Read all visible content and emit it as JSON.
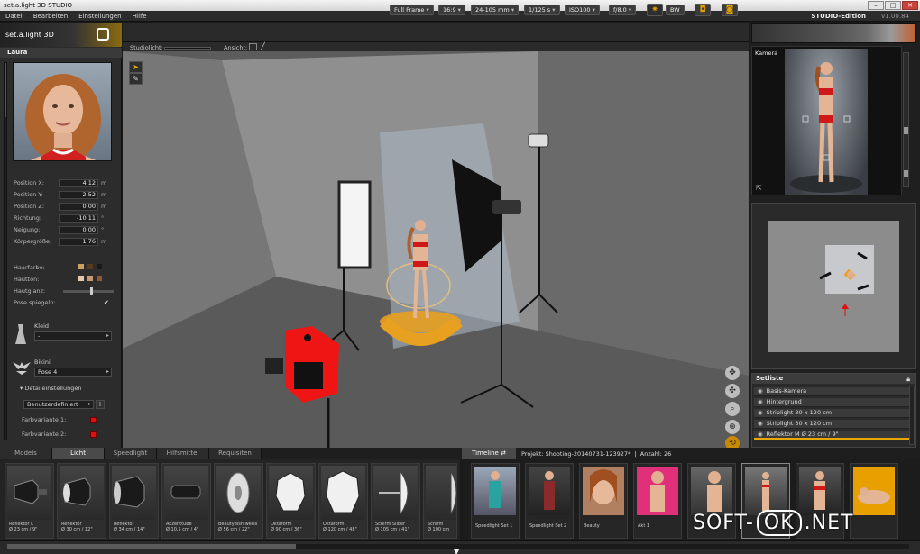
{
  "window": {
    "title": "set.a.light 3D STUDIO"
  },
  "menu": {
    "items": [
      "Datei",
      "Bearbeiten",
      "Einstellungen",
      "Hilfe"
    ],
    "edition": "STUDIO-Edition",
    "version": "v1.00.84"
  },
  "logo": {
    "text": "set.a.light 3D"
  },
  "toolbar": {
    "format": "Full Frame",
    "ratio": "16:9",
    "lens": "24-105 mm",
    "shutter": "1/125 s",
    "iso": "ISO100",
    "aperture": "f/8.0",
    "bw": "BW",
    "studiolicht_label": "Studiolicht:",
    "ansicht_label": "Ansicht:"
  },
  "model_panel": {
    "name": "Laura",
    "properties": [
      {
        "label": "Position X:",
        "value": "4.12",
        "unit": "m"
      },
      {
        "label": "Position Y:",
        "value": "2.52",
        "unit": "m"
      },
      {
        "label": "Position Z:",
        "value": "0.00",
        "unit": "m"
      },
      {
        "label": "Richtung:",
        "value": "-10.11",
        "unit": "°"
      },
      {
        "label": "Neigung:",
        "value": "0.00",
        "unit": "°"
      },
      {
        "label": "Körpergröße:",
        "value": "1.76",
        "unit": "m"
      }
    ],
    "haarfarbe": "Haarfarbe:",
    "hautton": "Hautton:",
    "hautglanz": "Hautglanz:",
    "pose_spiegeln": "Pose spiegeln:",
    "kleid_label": "Kleid",
    "kleid_value": "-",
    "bikini_label": "Bikini",
    "bikini_value": "Pose 4",
    "details_label": "Detaileinstellungen",
    "preset_value": "Benutzerdefiniert",
    "farb1": "Farbvariante 1:",
    "farb2": "Farbvariante 2:",
    "colors": {
      "hair": [
        "#c8a060",
        "#5a3a20",
        "#1a1a1a"
      ],
      "skin": [
        "#e8c8a8",
        "#c89870",
        "#8a5a3a"
      ],
      "variant": "#e01010"
    }
  },
  "camera_panel": {
    "title": "Kamera"
  },
  "setliste": {
    "title": "Setliste",
    "items": [
      "Basis-Kamera",
      "Hintergrund",
      "Striplight 30 x 120 cm",
      "Striplight 30 x 120 cm",
      "Reflektor M Ø 23 cm / 9\""
    ]
  },
  "bottom_tabs": [
    "Models",
    "Licht",
    "Speedlight",
    "Hilfsmittel",
    "Requisiten"
  ],
  "active_tab": "Licht",
  "library": [
    {
      "name": "Reflektor L",
      "size": "Ø 23 cm / 9\""
    },
    {
      "name": "Reflektor",
      "size": "Ø 30 cm / 12\""
    },
    {
      "name": "Reflektor",
      "size": "Ø 34 cm / 14\""
    },
    {
      "name": "Akzenttube",
      "size": "Ø 10,5 cm / 4\""
    },
    {
      "name": "Beautydish weiss",
      "size": "Ø 56 cm / 22\""
    },
    {
      "name": "Oktaform",
      "size": "Ø 90 cm / 36\""
    },
    {
      "name": "Oktaform",
      "size": "Ø 120 cm / 48\""
    },
    {
      "name": "Schirm Silber",
      "size": "Ø 105 cm / 41\""
    },
    {
      "name": "Schirm T",
      "size": "Ø 100 cm"
    }
  ],
  "timeline": {
    "tab": "Timeline",
    "project": "Projekt: Shooting-20140731-123927*",
    "count": "Anzahl: 26",
    "shots": [
      "Speedlight Set 1",
      "Speedlight Set 2",
      "Beauty",
      "Akt 1",
      "",
      "",
      "",
      "",
      ""
    ]
  },
  "watermark": {
    "pre": "SOFT-",
    "ok": "OK",
    "post": ".NET"
  }
}
